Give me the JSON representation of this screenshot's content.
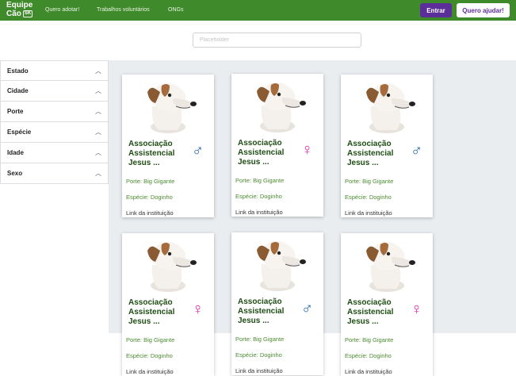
{
  "brand": {
    "name_line1": "Equipe",
    "name_line2": "Cão",
    "badge": "SK"
  },
  "nav": [
    {
      "label": "Quero adotar!"
    },
    {
      "label": "Trabalhos voluntários"
    },
    {
      "label": "ONGs"
    }
  ],
  "buttons": {
    "login": "Entrar",
    "help": "Quero ajudar!"
  },
  "search": {
    "placeholder": "Placeholder"
  },
  "filters": [
    {
      "label": "Estado"
    },
    {
      "label": "Cidade"
    },
    {
      "label": "Porte"
    },
    {
      "label": "Espécie"
    },
    {
      "label": "Idade"
    },
    {
      "label": "Sexo"
    }
  ],
  "cards": [
    {
      "name": "Associação Assistencial Jesus ...",
      "gender": "male",
      "gender_symbol": "♂",
      "porte": "Porte: Big Gigante",
      "especie": "Espécie: Doginho",
      "link": "Link da instituição"
    },
    {
      "name": "Associação Assistencial Jesus ...",
      "gender": "female",
      "gender_symbol": "♀",
      "porte": "Porte: Big Gigante",
      "especie": "Espécie: Doginho",
      "link": "Link da instituição"
    },
    {
      "name": "Associação Assistencial Jesus ...",
      "gender": "male",
      "gender_symbol": "♂",
      "porte": "Porte: Big Gigante",
      "especie": "Espécie: Doginho",
      "link": "Link da instituição"
    },
    {
      "name": "Associação Assistencial Jesus ...",
      "gender": "female",
      "gender_symbol": "♀",
      "porte": "Porte: Big Gigante",
      "especie": "Espécie: Doginho",
      "link": "Link da instituição"
    },
    {
      "name": "Associação Assistencial Jesus ...",
      "gender": "male",
      "gender_symbol": "♂",
      "porte": "Porte: Big Gigante",
      "especie": "Espécie: Doginho",
      "link": "Link da instituição"
    },
    {
      "name": "Associação Assistencial Jesus ...",
      "gender": "female",
      "gender_symbol": "♀",
      "porte": "Porte: Big Gigante",
      "especie": "Espécie: Doginho",
      "link": "Link da instituição"
    }
  ],
  "colors": {
    "header": "#3f8a2a",
    "primary_button": "#5b2e99",
    "male": "#2166b0",
    "female": "#e22bb3"
  }
}
